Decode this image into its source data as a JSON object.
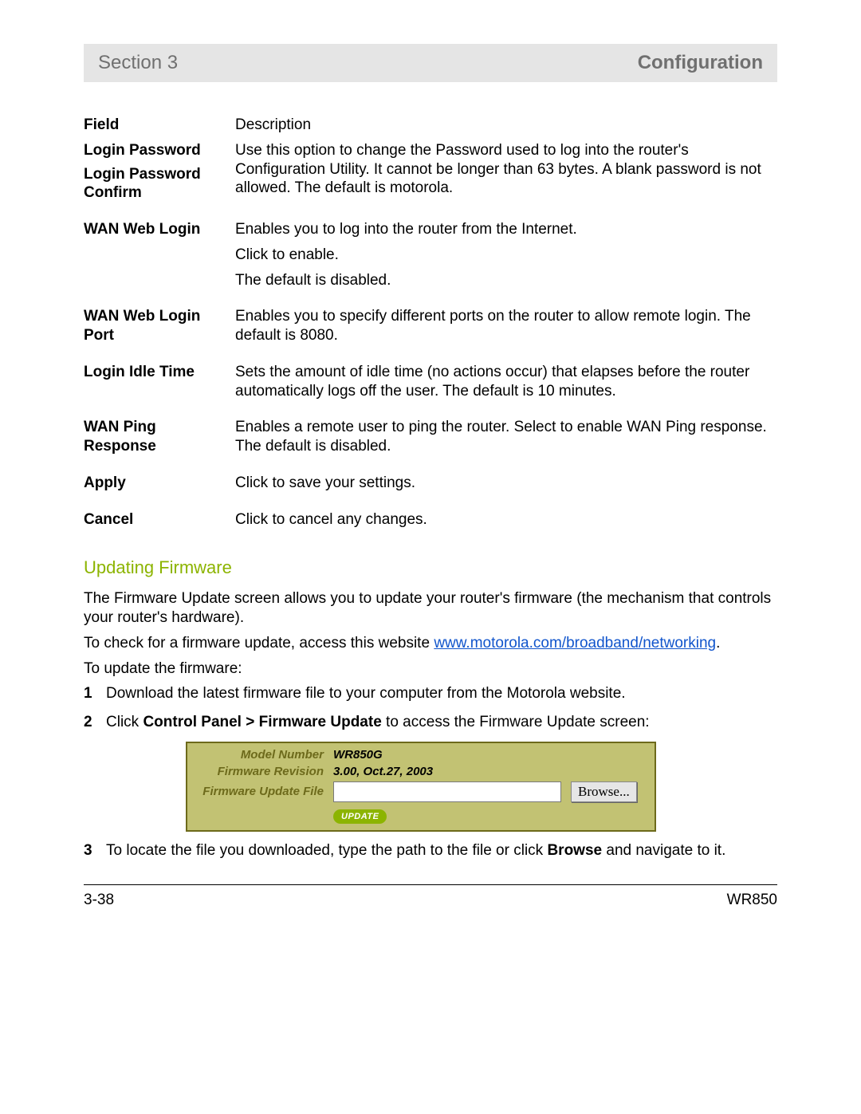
{
  "header": {
    "left": "Section 3",
    "right": "Configuration"
  },
  "fields": {
    "col_field": "Field",
    "col_desc": "Description",
    "login_password_label": "Login Password",
    "login_password_confirm_label": "Login Password Confirm",
    "login_password_desc": "Use this option to change the Password used to log into the router's Configuration Utility. It cannot be longer than 63 bytes. A blank password is not allowed. The default is motorola.",
    "wan_web_login_label": "WAN Web Login",
    "wan_web_login_desc1": "Enables you to log into the router from the Internet.",
    "wan_web_login_desc2": "Click to enable.",
    "wan_web_login_desc3": "The default is disabled.",
    "wan_web_login_port_label": "WAN Web Login Port",
    "wan_web_login_port_desc": "Enables you to specify different ports on the router to allow remote login. The default is 8080.",
    "login_idle_label": "Login Idle Time",
    "login_idle_desc": "Sets the amount of idle time (no actions occur) that elapses before the router automatically logs off the user. The default is 10 minutes.",
    "wan_ping_label": "WAN Ping Response",
    "wan_ping_desc": "Enables a remote user to ping the router. Select to enable WAN Ping response. The default is disabled.",
    "apply_label": "Apply",
    "apply_desc": "Click to save your settings.",
    "cancel_label": "Cancel",
    "cancel_desc": "Click to cancel any changes."
  },
  "section": {
    "title": "Updating Firmware",
    "para1": "The Firmware Update screen allows you to update your router's firmware (the mechanism that controls your router's hardware).",
    "para2_pre": "To check for a firmware update, access this website ",
    "para2_link": "www.motorola.com/broadband/networking",
    "para2_post": ".",
    "para3": "To update the firmware:",
    "step1": "Download the latest firmware file to your computer from the Motorola website.",
    "step2_a": "Click ",
    "step2_b": "Control Panel > Firmware Update",
    "step2_c": " to access the Firmware Update screen:",
    "step3_a": "To locate the file you downloaded, type the path to the file or click ",
    "step3_b": "Browse",
    "step3_c": " and navigate to it."
  },
  "firmware": {
    "model_label": "Model Number",
    "model_value": "WR850G",
    "rev_label": "Firmware Revision",
    "rev_value": "3.00, Oct.27, 2003",
    "file_label": "Firmware Update File",
    "browse_button": "Browse...",
    "update_button": "UPDATE"
  },
  "footer": {
    "left": "3-38",
    "right": "WR850"
  }
}
